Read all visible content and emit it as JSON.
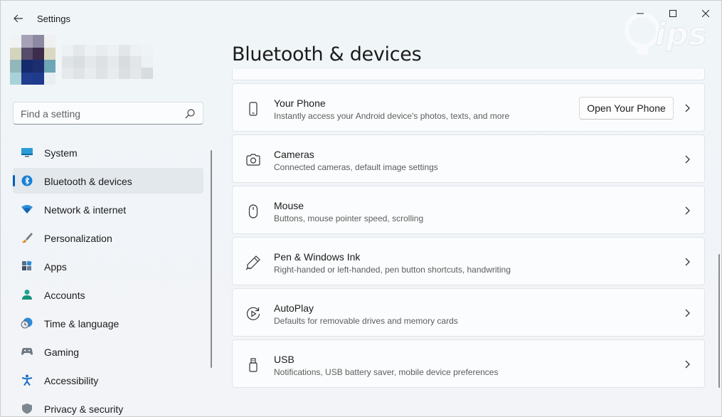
{
  "window": {
    "app_title": "Settings"
  },
  "search": {
    "placeholder": "Find a setting"
  },
  "nav": {
    "items": [
      {
        "label": "System",
        "icon": "monitor-icon"
      },
      {
        "label": "Bluetooth & devices",
        "icon": "bluetooth-icon",
        "active": true
      },
      {
        "label": "Network & internet",
        "icon": "wifi-icon"
      },
      {
        "label": "Personalization",
        "icon": "brush-icon"
      },
      {
        "label": "Apps",
        "icon": "apps-icon"
      },
      {
        "label": "Accounts",
        "icon": "person-icon"
      },
      {
        "label": "Time & language",
        "icon": "clock-globe-icon"
      },
      {
        "label": "Gaming",
        "icon": "gamepad-icon"
      },
      {
        "label": "Accessibility",
        "icon": "accessibility-icon"
      },
      {
        "label": "Privacy & security",
        "icon": "shield-icon"
      }
    ]
  },
  "main": {
    "title": "Bluetooth & devices",
    "cards": [
      {
        "title": "Your Phone",
        "desc": "Instantly access your Android device's photos, texts, and more",
        "icon": "phone-icon",
        "button": "Open Your Phone"
      },
      {
        "title": "Cameras",
        "desc": "Connected cameras, default image settings",
        "icon": "camera-icon"
      },
      {
        "title": "Mouse",
        "desc": "Buttons, mouse pointer speed, scrolling",
        "icon": "mouse-icon"
      },
      {
        "title": "Pen & Windows Ink",
        "desc": "Right-handed or left-handed, pen button shortcuts, handwriting",
        "icon": "pen-icon"
      },
      {
        "title": "AutoPlay",
        "desc": "Defaults for removable drives and memory cards",
        "icon": "autoplay-icon"
      },
      {
        "title": "USB",
        "desc": "Notifications, USB battery saver, mobile device preferences",
        "icon": "usb-icon"
      }
    ]
  },
  "colors": {
    "accent": "#005fb8",
    "background": "#eef3f6",
    "card": "#fbfcfd"
  }
}
